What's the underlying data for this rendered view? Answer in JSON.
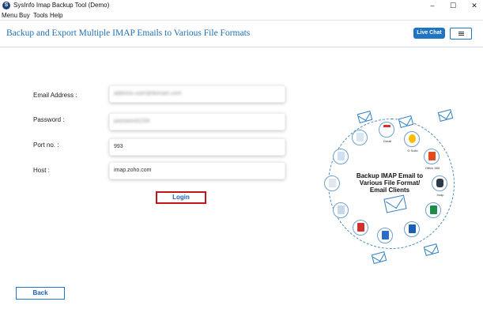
{
  "window": {
    "title": "SysInfo Imap Backup Tool (Demo)",
    "app_icon": "sysinfo-logo-icon",
    "controls": {
      "minimize": "–",
      "maximize": "☐",
      "close": "✕"
    }
  },
  "menu": [
    "Menu",
    "Buy",
    "Tools",
    "Help"
  ],
  "header": {
    "title": "Backup and Export Multiple IMAP Emails to Various File Formats",
    "live_chat_label": "Live Chat",
    "menu_icon": "hamburger-icon"
  },
  "form": {
    "email_label": "Email Address :",
    "email_value": "address.user@domain.com",
    "password_label": "Password  :",
    "password_value": "password1234",
    "port_label": "Port no.  :",
    "port_value": "993",
    "host_label": "Host  :",
    "host_value": "imap.zoho.com",
    "login_label": "Login"
  },
  "footer": {
    "back_label": "Back"
  },
  "illustration": {
    "center_text_line1": "Backup IMAP Email to",
    "center_text_line2": "Various File Format/",
    "center_text_line3": "Email Clients",
    "labels": {
      "gmail": "Gmail",
      "gsuite": "G Suite",
      "office365": "Office 365",
      "imap": "Imap"
    }
  },
  "colors": {
    "accent": "#1f74c4",
    "heading": "#1f6fb5",
    "login_border": "#c11717"
  }
}
